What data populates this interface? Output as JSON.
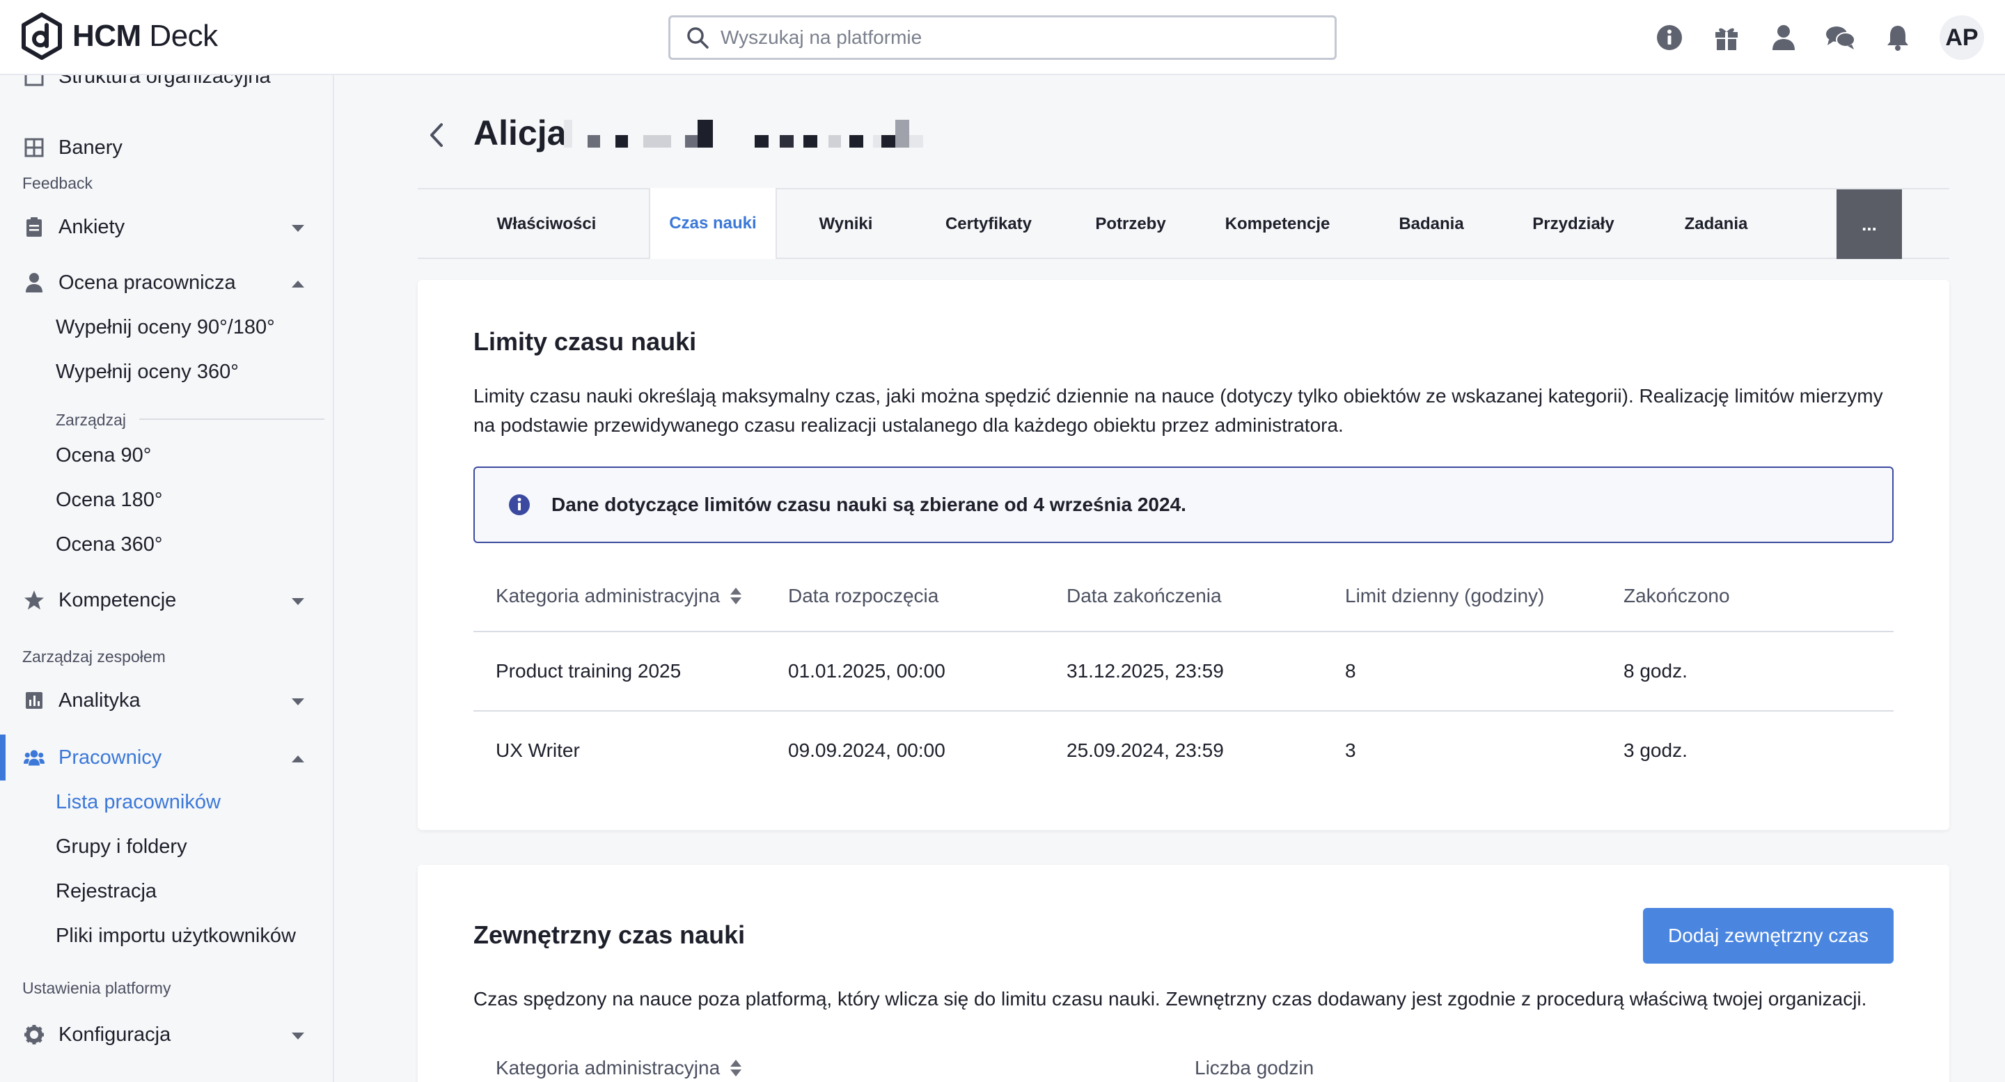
{
  "app": {
    "name_bold": "HCM",
    "name_rest": " Deck",
    "user_initials": "AP"
  },
  "search": {
    "placeholder": "Wyszukaj na platformie"
  },
  "sidebar": {
    "partial_top_label": "Struktura organizacyjna",
    "banery": "Banery",
    "feedback_heading": "Feedback",
    "ankiety": "Ankiety",
    "ocena": "Ocena pracownicza",
    "wypelnij_90_180": "Wypełnij oceny 90°/180°",
    "wypelnij_360": "Wypełnij oceny 360°",
    "zarzadzaj_heading": "Zarządzaj",
    "ocena_90": "Ocena 90°",
    "ocena_180": "Ocena 180°",
    "ocena_360": "Ocena 360°",
    "kompetencje": "Kompetencje",
    "zespol_heading": "Zarządzaj zespołem",
    "analityka": "Analityka",
    "pracownicy": "Pracownicy",
    "lista": "Lista pracowników",
    "grupy": "Grupy i foldery",
    "rejestracja": "Rejestracja",
    "pliki": "Pliki importu użytkowników",
    "ustawienia_heading": "Ustawienia platformy",
    "konfiguracja": "Konfiguracja"
  },
  "page": {
    "title": "Alicja"
  },
  "tabs": [
    "Właściwości",
    "Czas nauki",
    "Wyniki",
    "Certyfikaty",
    "Potrzeby",
    "Kompetencje",
    "Badania",
    "Przydziały",
    "Zadania"
  ],
  "tab_more": "...",
  "limits": {
    "title": "Limity czasu nauki",
    "description": "Limity czasu nauki określają maksymalny czas, jaki można spędzić dziennie na nauce (dotyczy tylko obiektów ze wskazanej kategorii). Realizację limitów mierzymy na podstawie przewidywanego czasu realizacji ustalanego dla każdego obiektu przez administratora.",
    "info": "Dane dotyczące limitów czasu nauki są zbierane od 4 września 2024.",
    "columns": [
      "Kategoria administracyjna",
      "Data rozpoczęcia",
      "Data zakończenia",
      "Limit dzienny (godziny)",
      "Zakończono"
    ],
    "rows": [
      [
        "Product training 2025",
        "01.01.2025, 00:00",
        "31.12.2025, 23:59",
        "8",
        "8 godz."
      ],
      [
        "UX Writer",
        "09.09.2024, 00:00",
        "25.09.2024, 23:59",
        "3",
        "3 godz."
      ]
    ]
  },
  "external": {
    "title": "Zewnętrzny czas nauki",
    "button": "Dodaj zewnętrzny czas",
    "description": "Czas spędzony na nauce poza platformą, który wlicza się do limitu czasu nauki. Zewnętrzny czas dodawany jest zgodnie z procedurą właściwą twojej organizacji.",
    "columns": [
      "Kategoria administracyjna",
      "Liczba godzin"
    ]
  },
  "colors": {
    "accent": "#3b78d8",
    "button": "#4a86e0",
    "info_border": "#3b4aa0",
    "text": "#1d1f2a"
  }
}
